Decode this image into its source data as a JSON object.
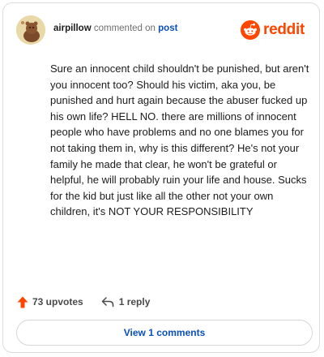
{
  "header": {
    "username": "airpillow",
    "commented_text": "commented on",
    "post_link": "post",
    "brand_name": "reddit",
    "brand_icon": "reddit-snoo-icon",
    "avatar_icon": "avatar-image"
  },
  "comment": {
    "body": "Sure an innocent child shouldn't be punished, but aren't you innocent too? Should his victim, aka you, be punished and hurt again because the abuser fucked up his own life? HELL NO. there are millions of innocent people who have problems and no one blames you for not taking them in, why is this different? He's not your family he made that clear, he won't be grateful or helpful, he will probably ruin your life and house. Sucks for the kid but just like all the other not your own children, it's NOT YOUR RESPONSIBILITY"
  },
  "actions": {
    "upvotes_label": "73 upvotes",
    "upvote_icon": "upvote-arrow-icon",
    "reply_label": "1 reply",
    "reply_icon": "reply-arrow-icon"
  },
  "footer": {
    "view_comments_label": "View 1 comments"
  },
  "colors": {
    "brand": "#ff4500",
    "link": "#0a4fb8",
    "text": "#1c1c1c",
    "muted": "#6f6f6f"
  }
}
